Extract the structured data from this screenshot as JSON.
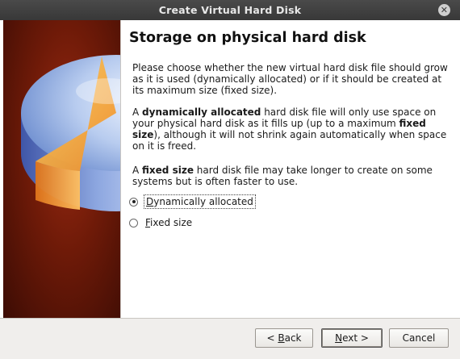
{
  "window": {
    "title": "Create Virtual Hard Disk",
    "close_icon": "close-icon"
  },
  "page": {
    "heading": "Storage on physical hard disk",
    "paragraph1": "Please choose whether the new virtual hard disk file should grow as it is used (dynamically allocated) or if it should be created at its maximum size (fixed size).",
    "paragraph2": {
      "pre": "A ",
      "bold1": "dynamically allocated",
      "mid": " hard disk file will only use space on your physical hard disk as it fills up (up to a maximum ",
      "bold2": "fixed size",
      "post": "), although it will not shrink again automatically when space on it is freed."
    },
    "paragraph3": {
      "pre": "A ",
      "bold": "fixed size",
      "post": " hard disk file may take longer to create on some systems but is often faster to use."
    },
    "options": [
      {
        "mnemonic": "D",
        "rest": "ynamically allocated",
        "checked": true
      },
      {
        "mnemonic": "F",
        "rest": "ixed size",
        "checked": false
      }
    ]
  },
  "buttons": {
    "back_pre": "< ",
    "back_mnemonic": "B",
    "back_rest": "ack",
    "next_mnemonic": "N",
    "next_rest": "ext >",
    "cancel": "Cancel"
  },
  "colors": {
    "title_bar": "#383838",
    "side_background": "#6e1a08",
    "disk_blue": "#8fb0e6",
    "disk_orange": "#f4a43a"
  }
}
